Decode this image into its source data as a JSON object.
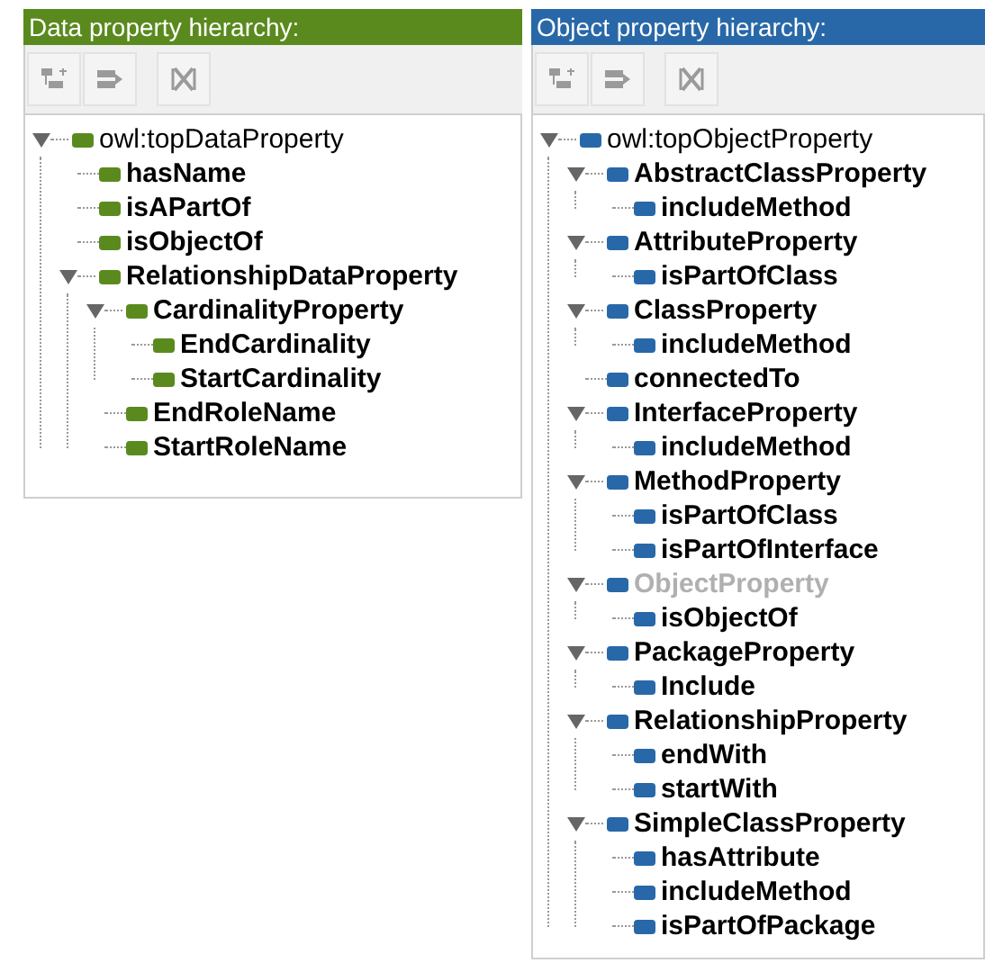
{
  "panels": [
    {
      "title": "Data property hierarchy:",
      "color": "#5a8a1e",
      "tree": [
        {
          "label": "owl:topDataProperty",
          "expanded": true,
          "disabled": false,
          "children": [
            {
              "label": "hasName",
              "disabled": false
            },
            {
              "label": "isAPartOf",
              "disabled": false
            },
            {
              "label": "isObjectOf",
              "disabled": false
            },
            {
              "label": "RelationshipDataProperty",
              "expanded": true,
              "disabled": false,
              "children": [
                {
                  "label": "CardinalityProperty",
                  "expanded": true,
                  "disabled": false,
                  "children": [
                    {
                      "label": "EndCardinality",
                      "disabled": false
                    },
                    {
                      "label": "StartCardinality",
                      "disabled": false
                    }
                  ]
                },
                {
                  "label": "EndRoleName",
                  "disabled": false
                },
                {
                  "label": "StartRoleName",
                  "disabled": false
                }
              ]
            }
          ]
        }
      ]
    },
    {
      "title": "Object property hierarchy:",
      "color": "#2868a8",
      "tree": [
        {
          "label": "owl:topObjectProperty",
          "expanded": true,
          "disabled": false,
          "children": [
            {
              "label": "AbstractClassProperty",
              "expanded": true,
              "disabled": false,
              "children": [
                {
                  "label": "includeMethod",
                  "disabled": false
                }
              ]
            },
            {
              "label": "AttributeProperty",
              "expanded": true,
              "disabled": false,
              "children": [
                {
                  "label": "isPartOfClass",
                  "disabled": false
                }
              ]
            },
            {
              "label": "ClassProperty",
              "expanded": true,
              "disabled": false,
              "children": [
                {
                  "label": "includeMethod",
                  "disabled": false
                }
              ]
            },
            {
              "label": "connectedTo",
              "disabled": false
            },
            {
              "label": "InterfaceProperty",
              "expanded": true,
              "disabled": false,
              "children": [
                {
                  "label": "includeMethod",
                  "disabled": false
                }
              ]
            },
            {
              "label": "MethodProperty",
              "expanded": true,
              "disabled": false,
              "children": [
                {
                  "label": "isPartOfClass",
                  "disabled": false
                },
                {
                  "label": "isPartOfInterface",
                  "disabled": false
                }
              ]
            },
            {
              "label": "ObjectProperty",
              "expanded": true,
              "disabled": true,
              "children": [
                {
                  "label": "isObjectOf",
                  "disabled": false
                }
              ]
            },
            {
              "label": "PackageProperty",
              "expanded": true,
              "disabled": false,
              "children": [
                {
                  "label": "Include",
                  "disabled": false
                }
              ]
            },
            {
              "label": "RelationshipProperty",
              "expanded": true,
              "disabled": false,
              "children": [
                {
                  "label": "endWith",
                  "disabled": false
                },
                {
                  "label": "startWith",
                  "disabled": false
                }
              ]
            },
            {
              "label": "SimpleClassProperty",
              "expanded": true,
              "disabled": false,
              "children": [
                {
                  "label": "hasAttribute",
                  "disabled": false
                },
                {
                  "label": "includeMethod",
                  "disabled": false
                },
                {
                  "label": "isPartOfPackage",
                  "disabled": false
                }
              ]
            }
          ]
        }
      ]
    }
  ]
}
